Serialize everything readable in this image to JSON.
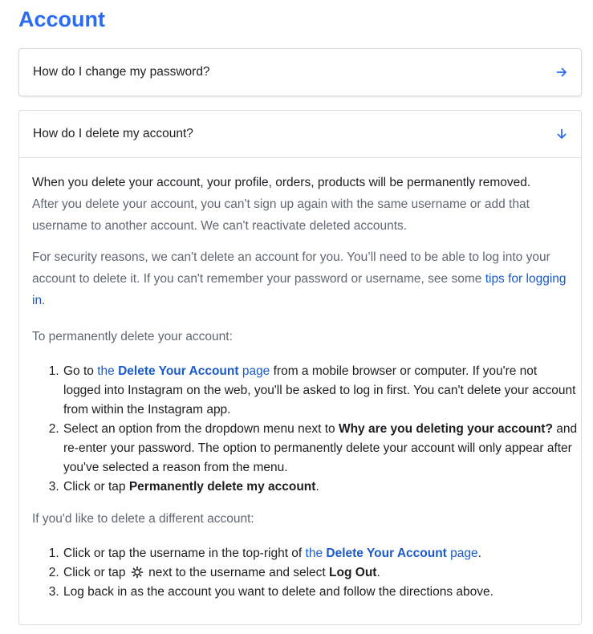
{
  "page": {
    "title": "Account"
  },
  "faq": [
    {
      "question": "How do I change my password?",
      "icon": "arrow-right-icon",
      "expanded": false
    },
    {
      "question": "How do I delete my account?",
      "icon": "arrow-down-icon",
      "expanded": true
    }
  ],
  "answer": {
    "p1_dark": "When you delete your account, your profile, orders, products will be permanently removed.",
    "p1_rest": "After you delete your account, you can't sign up again with the same username or add that username to another account. We can't reactivate deleted accounts.",
    "p2_text": "For security reasons, we can't delete an account for you. You’ll need to be able to log into your account to delete it. If you can't remember your password or username, see some ",
    "p2_link": "tips for logging in",
    "p2_end": ".",
    "p3": "To permanently delete your account:",
    "steps": [
      {
        "pre": "Go to ",
        "link_a": "the ",
        "link_b": "Delete Your Account",
        "link_c": " page",
        "post": " from a mobile browser or computer. If you're not logged into Instagram on the web, you'll be asked to log in first. You can't delete your account from within the Instagram app."
      },
      {
        "pre": "Select an option from the dropdown menu next to ",
        "bold": "Why are you deleting your account?",
        "post": " and re-enter your password. The option to permanently delete your account will only appear after you've selected a reason from the menu."
      },
      {
        "pre": "Click or tap ",
        "bold": "Permanently delete my account",
        "post": "."
      }
    ],
    "p4": "If you'd like to delete a different account:",
    "steps2": [
      {
        "pre": "Click or tap the username in the top-right of ",
        "link_a": "the ",
        "link_b": "Delete Your Account",
        "link_c": " page",
        "post": "."
      },
      {
        "pre": "Click or tap ",
        "icon": "gear-icon",
        "mid": " next to the username and select ",
        "bold": "Log Out",
        "post": "."
      },
      {
        "text": "Log back in as the account you want to delete and follow the directions above."
      }
    ]
  },
  "colors": {
    "accent": "#2a6bf2",
    "link": "#1a5ac8",
    "muted": "#606770",
    "text": "#1c1e21",
    "border": "#dadde1"
  }
}
